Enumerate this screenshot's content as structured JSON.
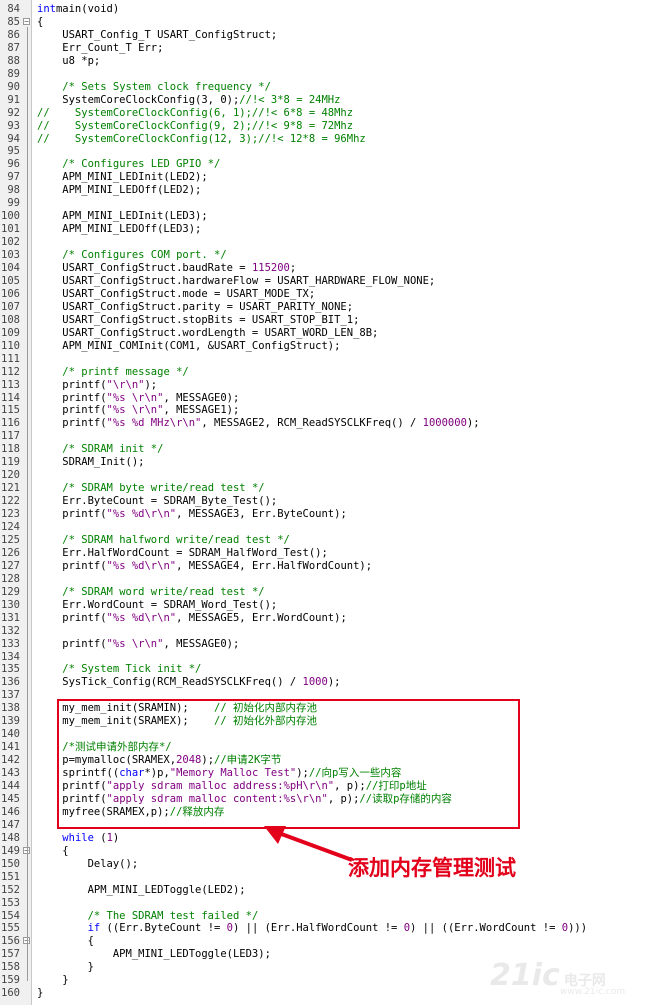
{
  "lines": [
    {
      "n": "84",
      "fold": "",
      "segs": [
        [
          "kw",
          "int"
        ],
        [
          "",
          "main(void)"
        ]
      ]
    },
    {
      "n": "85",
      "fold": "minus",
      "segs": [
        [
          "",
          "{"
        ]
      ]
    },
    {
      "n": "86",
      "fold": "",
      "segs": [
        [
          "",
          "    USART_Config_T USART_ConfigStruct;"
        ]
      ]
    },
    {
      "n": "87",
      "fold": "",
      "segs": [
        [
          "",
          "    Err_Count_T Err;"
        ]
      ]
    },
    {
      "n": "88",
      "fold": "",
      "segs": [
        [
          "",
          "    u8 *p;"
        ]
      ]
    },
    {
      "n": "89",
      "fold": "",
      "segs": []
    },
    {
      "n": "90",
      "fold": "",
      "segs": [
        [
          "",
          "    "
        ],
        [
          "cm",
          "/* Sets System clock frequency */"
        ]
      ]
    },
    {
      "n": "91",
      "fold": "",
      "segs": [
        [
          "",
          "    SystemCoreClockConfig(3, 0);"
        ],
        [
          "cm",
          "//!< 3*8 = 24MHz"
        ]
      ]
    },
    {
      "n": "92",
      "fold": "",
      "segs": [
        [
          "cm",
          "//    SystemCoreClockConfig(6, 1);//!< 6*8 = 48Mhz"
        ]
      ]
    },
    {
      "n": "93",
      "fold": "",
      "segs": [
        [
          "cm",
          "//    SystemCoreClockConfig(9, 2);//!< 9*8 = 72Mhz"
        ]
      ]
    },
    {
      "n": "94",
      "fold": "",
      "segs": [
        [
          "cm",
          "//    SystemCoreClockConfig(12, 3);//!< 12*8 = 96Mhz"
        ]
      ]
    },
    {
      "n": "95",
      "fold": "",
      "segs": []
    },
    {
      "n": "96",
      "fold": "",
      "segs": [
        [
          "",
          "    "
        ],
        [
          "cm",
          "/* Configures LED GPIO */"
        ]
      ]
    },
    {
      "n": "97",
      "fold": "",
      "segs": [
        [
          "",
          "    APM_MINI_LEDInit(LED2);"
        ]
      ]
    },
    {
      "n": "98",
      "fold": "",
      "segs": [
        [
          "",
          "    APM_MINI_LEDOff(LED2);"
        ]
      ]
    },
    {
      "n": "99",
      "fold": "",
      "segs": []
    },
    {
      "n": "100",
      "fold": "",
      "segs": [
        [
          "",
          "    APM_MINI_LEDInit(LED3);"
        ]
      ]
    },
    {
      "n": "101",
      "fold": "",
      "segs": [
        [
          "",
          "    APM_MINI_LEDOff(LED3);"
        ]
      ]
    },
    {
      "n": "102",
      "fold": "",
      "segs": []
    },
    {
      "n": "103",
      "fold": "",
      "segs": [
        [
          "",
          "    "
        ],
        [
          "cm",
          "/* Configures COM port. */"
        ]
      ]
    },
    {
      "n": "104",
      "fold": "",
      "segs": [
        [
          "",
          "    USART_ConfigStruct.baudRate = "
        ],
        [
          "nm",
          "115200"
        ],
        [
          "",
          ";"
        ]
      ]
    },
    {
      "n": "105",
      "fold": "",
      "segs": [
        [
          "",
          "    USART_ConfigStruct.hardwareFlow = USART_HARDWARE_FLOW_NONE;"
        ]
      ]
    },
    {
      "n": "106",
      "fold": "",
      "segs": [
        [
          "",
          "    USART_ConfigStruct.mode = USART_MODE_TX;"
        ]
      ]
    },
    {
      "n": "107",
      "fold": "",
      "segs": [
        [
          "",
          "    USART_ConfigStruct.parity = USART_PARITY_NONE;"
        ]
      ]
    },
    {
      "n": "108",
      "fold": "",
      "segs": [
        [
          "",
          "    USART_ConfigStruct.stopBits = USART_STOP_BIT_1;"
        ]
      ]
    },
    {
      "n": "109",
      "fold": "",
      "segs": [
        [
          "",
          "    USART_ConfigStruct.wordLength = USART_WORD_LEN_8B;"
        ]
      ]
    },
    {
      "n": "110",
      "fold": "",
      "segs": [
        [
          "",
          "    APM_MINI_COMInit(COM1, &USART_ConfigStruct);"
        ]
      ]
    },
    {
      "n": "111",
      "fold": "",
      "segs": []
    },
    {
      "n": "112",
      "fold": "",
      "segs": [
        [
          "",
          "    "
        ],
        [
          "cm",
          "/* printf message */"
        ]
      ]
    },
    {
      "n": "113",
      "fold": "",
      "segs": [
        [
          "",
          "    printf("
        ],
        [
          "st",
          "\"\\r\\n\""
        ],
        [
          "",
          ");"
        ]
      ]
    },
    {
      "n": "114",
      "fold": "",
      "segs": [
        [
          "",
          "    printf("
        ],
        [
          "st",
          "\"%s \\r\\n\""
        ],
        [
          "",
          ", MESSAGE0);"
        ]
      ]
    },
    {
      "n": "115",
      "fold": "",
      "segs": [
        [
          "",
          "    printf("
        ],
        [
          "st",
          "\"%s \\r\\n\""
        ],
        [
          "",
          ", MESSAGE1);"
        ]
      ]
    },
    {
      "n": "116",
      "fold": "",
      "segs": [
        [
          "",
          "    printf("
        ],
        [
          "st",
          "\"%s %d MHz\\r\\n\""
        ],
        [
          "",
          ", MESSAGE2, RCM_ReadSYSCLKFreq() / "
        ],
        [
          "nm",
          "1000000"
        ],
        [
          "",
          ");"
        ]
      ]
    },
    {
      "n": "117",
      "fold": "",
      "segs": []
    },
    {
      "n": "118",
      "fold": "",
      "segs": [
        [
          "",
          "    "
        ],
        [
          "cm",
          "/* SDRAM init */"
        ]
      ]
    },
    {
      "n": "119",
      "fold": "",
      "segs": [
        [
          "",
          "    SDRAM_Init();"
        ]
      ]
    },
    {
      "n": "120",
      "fold": "",
      "segs": []
    },
    {
      "n": "121",
      "fold": "",
      "segs": [
        [
          "",
          "    "
        ],
        [
          "cm",
          "/* SDRAM byte write/read test */"
        ]
      ]
    },
    {
      "n": "122",
      "fold": "",
      "segs": [
        [
          "",
          "    Err.ByteCount = SDRAM_Byte_Test();"
        ]
      ]
    },
    {
      "n": "123",
      "fold": "",
      "segs": [
        [
          "",
          "    printf("
        ],
        [
          "st",
          "\"%s %d\\r\\n\""
        ],
        [
          "",
          ", MESSAGE3, Err.ByteCount);"
        ]
      ]
    },
    {
      "n": "124",
      "fold": "",
      "segs": []
    },
    {
      "n": "125",
      "fold": "",
      "segs": [
        [
          "",
          "    "
        ],
        [
          "cm",
          "/* SDRAM halfword write/read test */"
        ]
      ]
    },
    {
      "n": "126",
      "fold": "",
      "segs": [
        [
          "",
          "    Err.HalfWordCount = SDRAM_HalfWord_Test();"
        ]
      ]
    },
    {
      "n": "127",
      "fold": "",
      "segs": [
        [
          "",
          "    printf("
        ],
        [
          "st",
          "\"%s %d\\r\\n\""
        ],
        [
          "",
          ", MESSAGE4, Err.HalfWordCount);"
        ]
      ]
    },
    {
      "n": "128",
      "fold": "",
      "segs": []
    },
    {
      "n": "129",
      "fold": "",
      "segs": [
        [
          "",
          "    "
        ],
        [
          "cm",
          "/* SDRAM word write/read test */"
        ]
      ]
    },
    {
      "n": "130",
      "fold": "",
      "segs": [
        [
          "",
          "    Err.WordCount = SDRAM_Word_Test();"
        ]
      ]
    },
    {
      "n": "131",
      "fold": "",
      "segs": [
        [
          "",
          "    printf("
        ],
        [
          "st",
          "\"%s %d\\r\\n\""
        ],
        [
          "",
          ", MESSAGE5, Err.WordCount);"
        ]
      ]
    },
    {
      "n": "132",
      "fold": "",
      "segs": []
    },
    {
      "n": "133",
      "fold": "",
      "segs": [
        [
          "",
          "    printf("
        ],
        [
          "st",
          "\"%s \\r\\n\""
        ],
        [
          "",
          ", MESSAGE0);"
        ]
      ]
    },
    {
      "n": "134",
      "fold": "",
      "segs": []
    },
    {
      "n": "135",
      "fold": "",
      "segs": [
        [
          "",
          "    "
        ],
        [
          "cm",
          "/* System Tick init */"
        ]
      ]
    },
    {
      "n": "136",
      "fold": "",
      "segs": [
        [
          "",
          "    SysTick_Config(RCM_ReadSYSCLKFreq() / "
        ],
        [
          "nm",
          "1000"
        ],
        [
          "",
          ");"
        ]
      ]
    },
    {
      "n": "137",
      "fold": "",
      "segs": []
    },
    {
      "n": "138",
      "fold": "",
      "segs": [
        [
          "",
          "    my_mem_init(SRAMIN);    "
        ],
        [
          "cm",
          "// 初始化内部内存池"
        ]
      ]
    },
    {
      "n": "139",
      "fold": "",
      "segs": [
        [
          "",
          "    my_mem_init(SRAMEX);    "
        ],
        [
          "cm",
          "// 初始化外部内存池"
        ]
      ]
    },
    {
      "n": "140",
      "fold": "",
      "segs": []
    },
    {
      "n": "141",
      "fold": "",
      "segs": [
        [
          "",
          "    "
        ],
        [
          "cm",
          "/*测试申请外部内存*/"
        ]
      ]
    },
    {
      "n": "142",
      "fold": "",
      "segs": [
        [
          "",
          "    p=mymalloc(SRAMEX,"
        ],
        [
          "nm",
          "2048"
        ],
        [
          "",
          ");"
        ],
        [
          "cm",
          "//申请2K字节"
        ]
      ]
    },
    {
      "n": "143",
      "fold": "",
      "segs": [
        [
          "",
          "    sprintf(("
        ],
        [
          "kw",
          "char"
        ],
        [
          "",
          "*)p,"
        ],
        [
          "st",
          "\"Memory Malloc Test\""
        ],
        [
          "",
          ");"
        ],
        [
          "cm",
          "//向p写入一些内容"
        ]
      ]
    },
    {
      "n": "144",
      "fold": "",
      "segs": [
        [
          "",
          "    printf("
        ],
        [
          "st",
          "\"apply sdram malloc address:%pH\\r\\n\""
        ],
        [
          "",
          ", p);"
        ],
        [
          "cm",
          "//打印p地址"
        ]
      ]
    },
    {
      "n": "145",
      "fold": "",
      "segs": [
        [
          "",
          "    printf("
        ],
        [
          "st",
          "\"apply sdram malloc content:%s\\r\\n\""
        ],
        [
          "",
          ", p);"
        ],
        [
          "cm",
          "//读取p存储的内容"
        ]
      ]
    },
    {
      "n": "146",
      "fold": "",
      "segs": [
        [
          "",
          "    myfree(SRAMEX,p);"
        ],
        [
          "cm",
          "//释放内存"
        ]
      ]
    },
    {
      "n": "147",
      "fold": "",
      "segs": []
    },
    {
      "n": "148",
      "fold": "",
      "segs": [
        [
          "",
          "    "
        ],
        [
          "kw",
          "while"
        ],
        [
          "",
          " ("
        ],
        [
          "nm",
          "1"
        ],
        [
          "",
          ")"
        ]
      ]
    },
    {
      "n": "149",
      "fold": "minus",
      "segs": [
        [
          "",
          "    {"
        ]
      ]
    },
    {
      "n": "150",
      "fold": "",
      "segs": [
        [
          "",
          "        Delay();"
        ]
      ]
    },
    {
      "n": "151",
      "fold": "",
      "segs": []
    },
    {
      "n": "152",
      "fold": "",
      "segs": [
        [
          "",
          "        APM_MINI_LEDToggle(LED2);"
        ]
      ]
    },
    {
      "n": "153",
      "fold": "",
      "segs": []
    },
    {
      "n": "154",
      "fold": "",
      "segs": [
        [
          "",
          "        "
        ],
        [
          "cm",
          "/* The SDRAM test failed */"
        ]
      ]
    },
    {
      "n": "155",
      "fold": "",
      "segs": [
        [
          "",
          "        "
        ],
        [
          "kw",
          "if"
        ],
        [
          "",
          " ((Err.ByteCount != "
        ],
        [
          "nm",
          "0"
        ],
        [
          "",
          ") || (Err.HalfWordCount != "
        ],
        [
          "nm",
          "0"
        ],
        [
          "",
          ") || ((Err.WordCount != "
        ],
        [
          "nm",
          "0"
        ],
        [
          "",
          ")))"
        ]
      ]
    },
    {
      "n": "156",
      "fold": "minus",
      "segs": [
        [
          "",
          "        {"
        ]
      ]
    },
    {
      "n": "157",
      "fold": "",
      "segs": [
        [
          "",
          "            APM_MINI_LEDToggle(LED3);"
        ]
      ]
    },
    {
      "n": "158",
      "fold": "",
      "segs": [
        [
          "",
          "        }"
        ]
      ]
    },
    {
      "n": "159",
      "fold": "",
      "segs": [
        [
          "",
          "    }"
        ]
      ]
    },
    {
      "n": "160",
      "fold": "",
      "segs": [
        [
          "",
          "}"
        ]
      ]
    }
  ],
  "annotation": {
    "text": "添加内存管理测试",
    "color": "#e3001b"
  },
  "watermark": {
    "main": "21ic",
    "sub_cn": "电子网",
    "sub_en": "www.21ic.com"
  },
  "colors": {
    "keyword": "#0000ff",
    "comment": "#008000",
    "string": "#800080",
    "number": "#800080",
    "highlight": "#e3001b"
  }
}
